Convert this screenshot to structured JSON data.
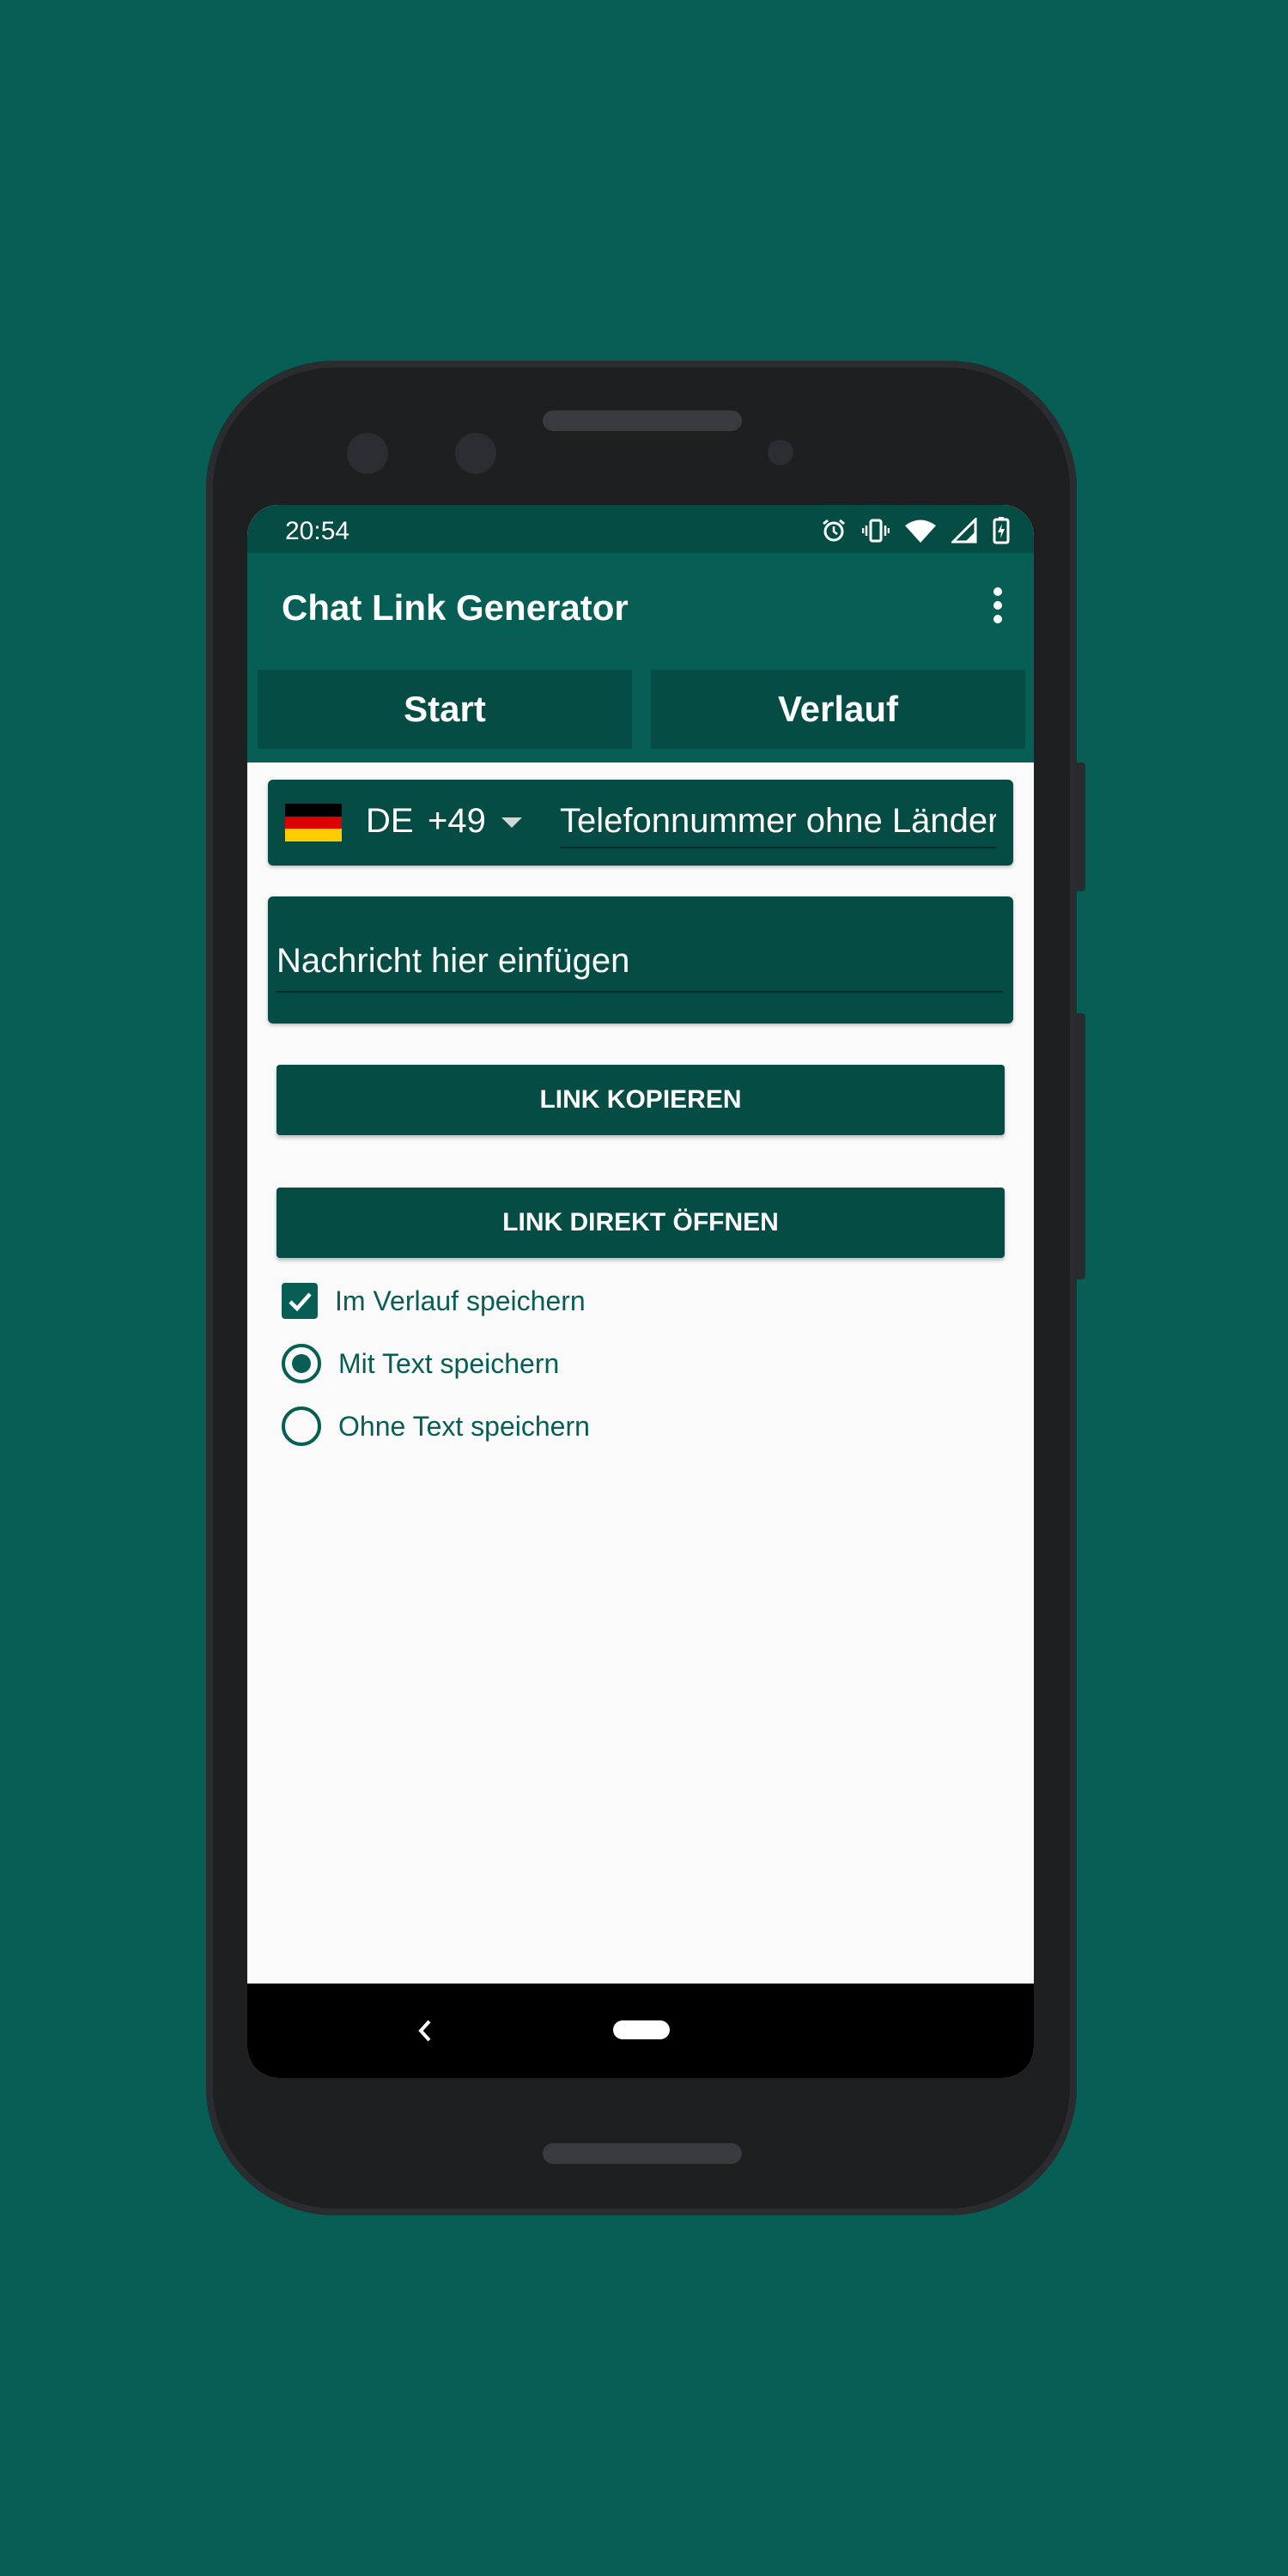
{
  "status_bar": {
    "time": "20:54",
    "icons": [
      "alarm-icon",
      "vibrate-icon",
      "wifi-icon",
      "signal-icon",
      "battery-charging-icon"
    ]
  },
  "app_bar": {
    "title": "Chat Link Generator",
    "menu_icon": "more-vert-icon"
  },
  "tabs": [
    {
      "label": "Start"
    },
    {
      "label": "Verlauf"
    }
  ],
  "phone_input": {
    "country_code": "DE",
    "dial_code": "+49",
    "placeholder": "Telefonnummer ohne Länderkennzahl",
    "flag_colors": [
      "#000000",
      "#dd0000",
      "#ffcc00"
    ]
  },
  "message_input": {
    "placeholder": "Nachricht hier einfügen"
  },
  "buttons": {
    "copy_link": "LINK KOPIEREN",
    "open_link": "LINK DIREKT ÖFFNEN"
  },
  "options": {
    "save_history": {
      "label": "Im Verlauf speichern",
      "checked": true
    },
    "with_text": {
      "label": "Mit Text speichern",
      "selected": true
    },
    "without_text": {
      "label": "Ohne Text speichern",
      "selected": false
    }
  },
  "colors": {
    "background": "#075e54",
    "primary_dark": "#054d44",
    "screen_bg": "#fafafa"
  }
}
